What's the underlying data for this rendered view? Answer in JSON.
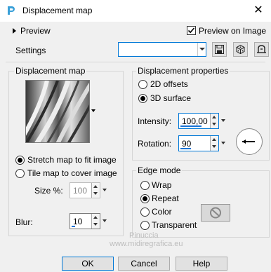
{
  "window": {
    "title": "Displacement map",
    "close_glyph": "✕"
  },
  "preview": {
    "label": "Preview",
    "preview_on_image_label": "Preview on Image",
    "preview_on_image_checked": true
  },
  "settings": {
    "label": "Settings",
    "value": ""
  },
  "displacement_map": {
    "title": "Displacement map",
    "stretch_label": "Stretch map to fit image",
    "tile_label": "Tile map to cover image",
    "selected": "stretch",
    "size_label": "Size %:",
    "size_value": "100",
    "blur_label": "Blur:",
    "blur_value": "10"
  },
  "displacement_properties": {
    "title": "Displacement properties",
    "offsets_label": "2D offsets",
    "surface_label": "3D surface",
    "selected": "3d",
    "intensity_label": "Intensity:",
    "intensity_value": "100,00",
    "rotation_label": "Rotation:",
    "rotation_value": "90"
  },
  "edge_mode": {
    "title": "Edge mode",
    "wrap_label": "Wrap",
    "repeat_label": "Repeat",
    "color_label": "Color",
    "transparent_label": "Transparent",
    "selected": "repeat"
  },
  "buttons": {
    "ok": "OK",
    "cancel": "Cancel",
    "help": "Help"
  },
  "watermark": {
    "line1": "Pinuccia",
    "line2": "www.midiregrafica.eu"
  },
  "colors": {
    "accent": "#0078d7",
    "bar": "#1a73d6"
  }
}
